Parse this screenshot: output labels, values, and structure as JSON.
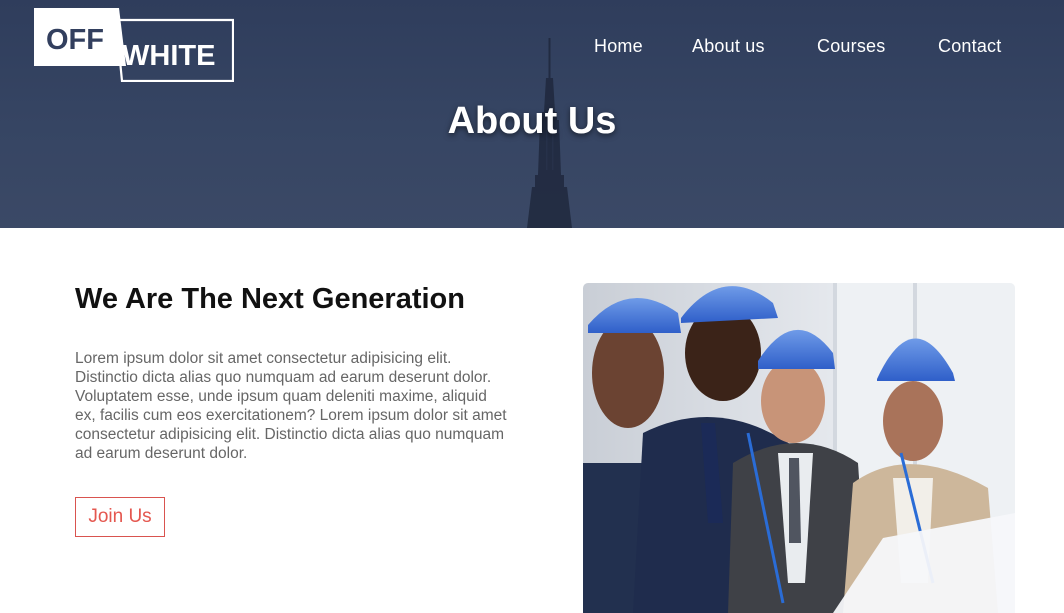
{
  "header": {
    "logo": {
      "word1": "OFF",
      "word2": "WHITE"
    },
    "nav": [
      {
        "label": "Home"
      },
      {
        "label": "About us"
      },
      {
        "label": "Courses"
      },
      {
        "label": "Contact"
      }
    ],
    "title": "About Us"
  },
  "main": {
    "heading": "We Are The Next Generation",
    "paragraph": "Lorem ipsum dolor sit amet consectetur adipisicing elit. Distinctio dicta alias quo numquam ad earum deserunt dolor. Voluptatem esse, unde ipsum quam deleniti maxime, aliquid ex, facilis cum eos exercitationem? Lorem ipsum dolor sit amet consectetur adipisicing elit. Distinctio dicta alias quo numquam ad earum deserunt dolor.",
    "cta_label": "Join Us"
  },
  "colors": {
    "hero_bg": "#323f5e",
    "accent": "#e4574f",
    "heading": "#111111",
    "body_text": "#666666"
  }
}
